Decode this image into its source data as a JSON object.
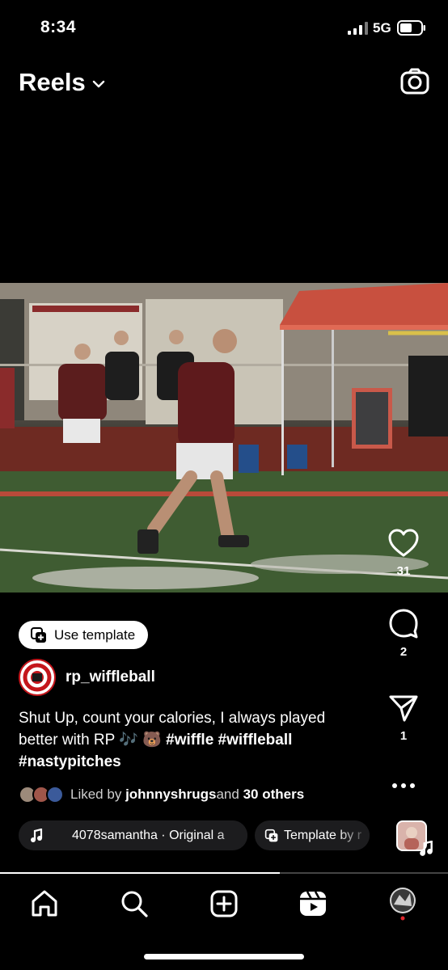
{
  "status_bar": {
    "time": "8:34",
    "network": "5G"
  },
  "header": {
    "title": "Reels"
  },
  "actions": {
    "likes_count": "31",
    "comments_count": "2",
    "shares_count": "1"
  },
  "post": {
    "template_button": "Use template",
    "author": "rp_wiffleball",
    "caption_text": "Shut Up, count your calories, I always played better with RP 🎶 🐻 ",
    "hashtags": "#wiffle #wiffleball #nastypitches",
    "liked_by_prefix": "Liked by ",
    "liked_by_user": "johnnyshrugs",
    "liked_by_and": " and ",
    "liked_by_others": "30 others",
    "audio": "4078samantha · Original a",
    "template_pill": "Template by r"
  },
  "progress_fraction": 0.625,
  "colors": {
    "background": "#000000",
    "accent_red": "#c4161c",
    "pill_bg": "#1c1c1e"
  },
  "icons": [
    "chevron-down-icon",
    "camera-icon",
    "heart-icon",
    "comment-icon",
    "share-icon",
    "more-icon",
    "music-note-icon",
    "template-icon",
    "home-icon",
    "search-icon",
    "create-icon",
    "reels-icon"
  ]
}
